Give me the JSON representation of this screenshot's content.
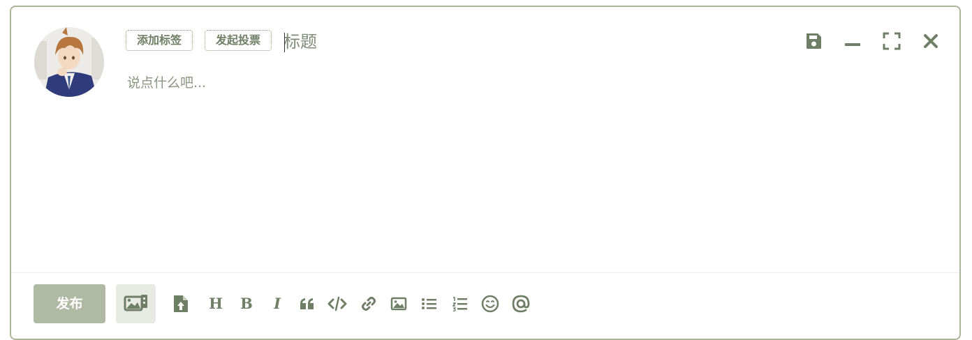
{
  "tags": {
    "add_tag_label": "添加标签",
    "start_vote_label": "发起投票"
  },
  "editor": {
    "title_placeholder": "标题",
    "body_placeholder": "说点什么吧..."
  },
  "window_controls": [
    "save-icon",
    "minimize-icon",
    "fullscreen-icon",
    "close-icon"
  ],
  "footer": {
    "publish_label": "发布"
  },
  "toolbar": {
    "icons": [
      "upload-file-icon",
      "heading-icon",
      "bold-icon",
      "italic-icon",
      "quote-icon",
      "code-icon",
      "link-icon",
      "image-icon",
      "bullet-list-icon",
      "numbered-list-icon",
      "emoji-icon",
      "mention-icon"
    ],
    "heading_text": "H",
    "bold_text": "B",
    "italic_text": "I"
  },
  "colors": {
    "accent": "#6f7f66",
    "border": "#aab59c",
    "publish_bg": "#b0b9a3"
  }
}
